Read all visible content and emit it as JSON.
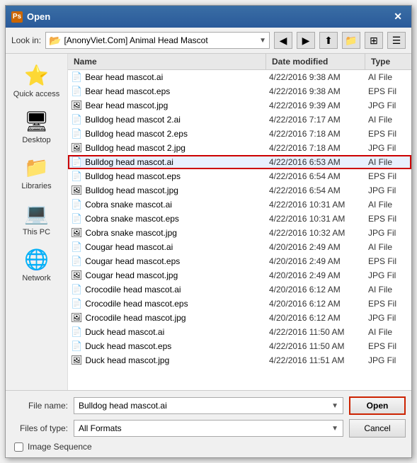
{
  "dialog": {
    "title": "Open",
    "title_icon": "Ps"
  },
  "toolbar": {
    "look_in_label": "Look in:",
    "look_in_value": "[AnonyViet.Com] Animal Head Mascot",
    "buttons": [
      "back",
      "forward",
      "up",
      "new-folder",
      "views"
    ]
  },
  "sidebar": {
    "items": [
      {
        "id": "quick-access",
        "label": "Quick access",
        "icon": "⭐"
      },
      {
        "id": "desktop",
        "label": "Desktop",
        "icon": "🖥"
      },
      {
        "id": "libraries",
        "label": "Libraries",
        "icon": "📁"
      },
      {
        "id": "this-pc",
        "label": "This PC",
        "icon": "💻"
      },
      {
        "id": "network",
        "label": "Network",
        "icon": "🌐"
      }
    ]
  },
  "file_list": {
    "columns": [
      {
        "id": "name",
        "label": "Name"
      },
      {
        "id": "date",
        "label": "Date modified"
      },
      {
        "id": "type",
        "label": "Type"
      }
    ],
    "files": [
      {
        "name": "Bear head mascot.ai",
        "date": "4/22/2016 9:38 AM",
        "type": "AI File",
        "icon": "📄",
        "selected": false
      },
      {
        "name": "Bear head mascot.eps",
        "date": "4/22/2016 9:38 AM",
        "type": "EPS Fil",
        "icon": "📄",
        "selected": false
      },
      {
        "name": "Bear head mascot.jpg",
        "date": "4/22/2016 9:39 AM",
        "type": "JPG Fil",
        "icon": "🖼",
        "selected": false
      },
      {
        "name": "Bulldog head mascot 2.ai",
        "date": "4/22/2016 7:17 AM",
        "type": "AI File",
        "icon": "📄",
        "selected": false
      },
      {
        "name": "Bulldog head mascot 2.eps",
        "date": "4/22/2016 7:18 AM",
        "type": "EPS Fil",
        "icon": "📄",
        "selected": false
      },
      {
        "name": "Bulldog head mascot 2.jpg",
        "date": "4/22/2016 7:18 AM",
        "type": "JPG Fil",
        "icon": "🖼",
        "selected": false
      },
      {
        "name": "Bulldog head mascot.ai",
        "date": "4/22/2016 6:53 AM",
        "type": "AI File",
        "icon": "📄",
        "selected": true
      },
      {
        "name": "Bulldog head mascot.eps",
        "date": "4/22/2016 6:54 AM",
        "type": "EPS Fil",
        "icon": "📄",
        "selected": false
      },
      {
        "name": "Bulldog head mascot.jpg",
        "date": "4/22/2016 6:54 AM",
        "type": "JPG Fil",
        "icon": "🖼",
        "selected": false
      },
      {
        "name": "Cobra snake mascot.ai",
        "date": "4/22/2016 10:31 AM",
        "type": "AI File",
        "icon": "📄",
        "selected": false
      },
      {
        "name": "Cobra snake mascot.eps",
        "date": "4/22/2016 10:31 AM",
        "type": "EPS Fil",
        "icon": "📄",
        "selected": false
      },
      {
        "name": "Cobra snake mascot.jpg",
        "date": "4/22/2016 10:32 AM",
        "type": "JPG Fil",
        "icon": "🖼",
        "selected": false
      },
      {
        "name": "Cougar head mascot.ai",
        "date": "4/20/2016 2:49 AM",
        "type": "AI File",
        "icon": "📄",
        "selected": false
      },
      {
        "name": "Cougar head mascot.eps",
        "date": "4/20/2016 2:49 AM",
        "type": "EPS Fil",
        "icon": "📄",
        "selected": false
      },
      {
        "name": "Cougar head mascot.jpg",
        "date": "4/20/2016 2:49 AM",
        "type": "JPG Fil",
        "icon": "🖼",
        "selected": false
      },
      {
        "name": "Crocodile head mascot.ai",
        "date": "4/20/2016 6:12 AM",
        "type": "AI File",
        "icon": "📄",
        "selected": false
      },
      {
        "name": "Crocodile head mascot.eps",
        "date": "4/20/2016 6:12 AM",
        "type": "EPS Fil",
        "icon": "📄",
        "selected": false
      },
      {
        "name": "Crocodile head mascot.jpg",
        "date": "4/20/2016 6:12 AM",
        "type": "JPG Fil",
        "icon": "🖼",
        "selected": false
      },
      {
        "name": "Duck head mascot.ai",
        "date": "4/22/2016 11:50 AM",
        "type": "AI File",
        "icon": "📄",
        "selected": false
      },
      {
        "name": "Duck head mascot.eps",
        "date": "4/22/2016 11:50 AM",
        "type": "EPS Fil",
        "icon": "📄",
        "selected": false
      },
      {
        "name": "Duck head mascot.jpg",
        "date": "4/22/2016 11:51 AM",
        "type": "JPG Fil",
        "icon": "🖼",
        "selected": false
      }
    ]
  },
  "bottom": {
    "file_name_label": "File name:",
    "file_name_value": "Bulldog head mascot.ai",
    "files_of_type_label": "Files of type:",
    "files_of_type_value": "All Formats",
    "open_label": "Open",
    "cancel_label": "Cancel",
    "checkbox_label": "Image Sequence"
  }
}
